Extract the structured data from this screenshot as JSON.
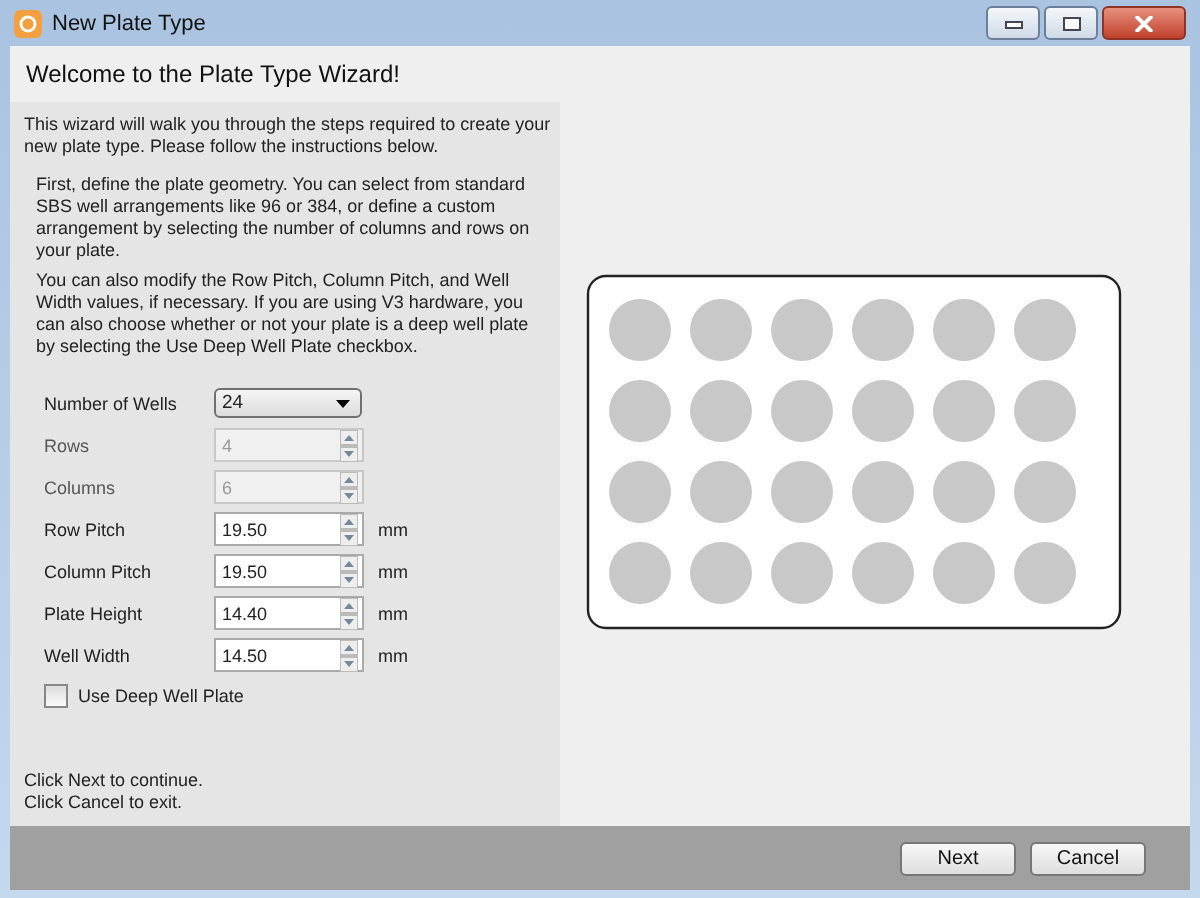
{
  "window": {
    "title": "New Plate Type"
  },
  "header": "Welcome to the Plate Type Wizard!",
  "intro": "This wizard will walk you through the steps required to create your new plate type. Please follow the instructions below.",
  "paragraphs": [
    "First, define the plate geometry. You can select from standard SBS well arrangements like 96 or 384, or define a custom arrangement by selecting the number of columns and rows on your plate.",
    "You can also modify the Row Pitch, Column Pitch, and Well Width values, if necessary. If you are using V3 hardware, you can also choose whether or not your plate is a deep well plate by selecting the Use Deep Well Plate checkbox."
  ],
  "fields": [
    {
      "kind": "dropdown",
      "label": "Number of Wells",
      "value": "24"
    },
    {
      "kind": "spinner",
      "label": "Rows",
      "value": "4",
      "disabled": true
    },
    {
      "kind": "spinner",
      "label": "Columns",
      "value": "6",
      "disabled": true
    },
    {
      "kind": "spinner",
      "label": "Row Pitch",
      "value": "19.50",
      "unit": "mm",
      "disabled": false
    },
    {
      "kind": "spinner",
      "label": "Column Pitch",
      "value": "19.50",
      "unit": "mm",
      "disabled": false
    },
    {
      "kind": "spinner",
      "label": "Plate Height",
      "value": "14.40",
      "unit": "mm",
      "disabled": false
    },
    {
      "kind": "spinner",
      "label": "Well Width",
      "value": "14.50",
      "unit": "mm",
      "disabled": false
    }
  ],
  "deep_well": {
    "label": "Use Deep Well Plate",
    "checked": false
  },
  "footer_notes": [
    "Click Next to continue.",
    "Click Cancel to exit."
  ],
  "buttons": [
    "Next",
    "Cancel"
  ]
}
